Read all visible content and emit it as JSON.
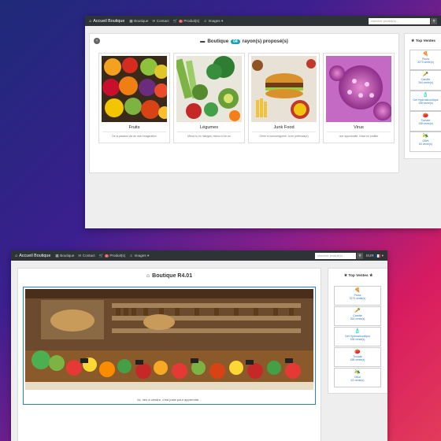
{
  "top_window": {
    "nav": {
      "brand": "Accueil Boutique",
      "items": [
        "Boutique",
        "Contact",
        "Produit(s)",
        "Images"
      ],
      "cart_count": "0",
      "search_placeholder": "chercher produit(s)...",
      "currency": "EUR"
    },
    "header": {
      "prefix": "Boutique",
      "count": "04",
      "suffix": "rayon(s) proposé(s)"
    },
    "categories": [
      {
        "name": "Fruits",
        "desc": "De la passion via de mon imagination"
      },
      {
        "name": "Légumes",
        "desc": "Mieux tu en manges, mieux tu en es"
      },
      {
        "name": "Junk Food",
        "desc": "Orme et consomigrène, tu en prêterais(e)"
      },
      {
        "name": "Virus",
        "desc": "une opportunité, il faut en profiter"
      }
    ],
    "top_sales": {
      "title": "Top Ventes",
      "items": [
        {
          "name": "Pizza",
          "count": "3273 vente(s)",
          "icon": "pizza-icon"
        },
        {
          "name": "Carotte",
          "count": "264 vente(s)",
          "icon": "carrot-icon"
        },
        {
          "name": "Gel Hydroalcoolique",
          "count": "158 vente(s)",
          "icon": "gel-icon"
        },
        {
          "name": "Tomate",
          "count": "158 vente(s)",
          "icon": "tomato-icon"
        },
        {
          "name": "Olive",
          "count": "63 vente(s)",
          "icon": "olive-icon"
        }
      ]
    }
  },
  "bottom_window": {
    "nav": {
      "brand": "Accueil Boutique",
      "items": [
        "Boutique",
        "Contact",
        "Produit(s)",
        "Images"
      ],
      "cart_count": "0",
      "search_placeholder": "chercher produit(s)...",
      "currency": "EUR"
    },
    "header": {
      "title": "Boutique R4.01"
    },
    "caption": "Ici, rien à vendre, c'est juste pour apprendre...",
    "top_sales": {
      "title": "Top Ventes",
      "items": [
        {
          "name": "Pizza",
          "count": "3273 vente(s)",
          "icon": "pizza-icon"
        },
        {
          "name": "Carotte",
          "count": "264 vente(s)",
          "icon": "carrot-icon"
        },
        {
          "name": "Gel Hydroalcoolique",
          "count": "158 vente(s)",
          "icon": "gel-icon"
        },
        {
          "name": "Tomate",
          "count": "158 vente(s)",
          "icon": "tomato-icon"
        },
        {
          "name": "Olive",
          "count": "63 vente(s)",
          "icon": "olive-icon"
        }
      ]
    }
  },
  "colors": {
    "navbar": "#2e3338",
    "accent": "#17a2b8",
    "link": "#337ab7",
    "badge": "#d9534f"
  }
}
